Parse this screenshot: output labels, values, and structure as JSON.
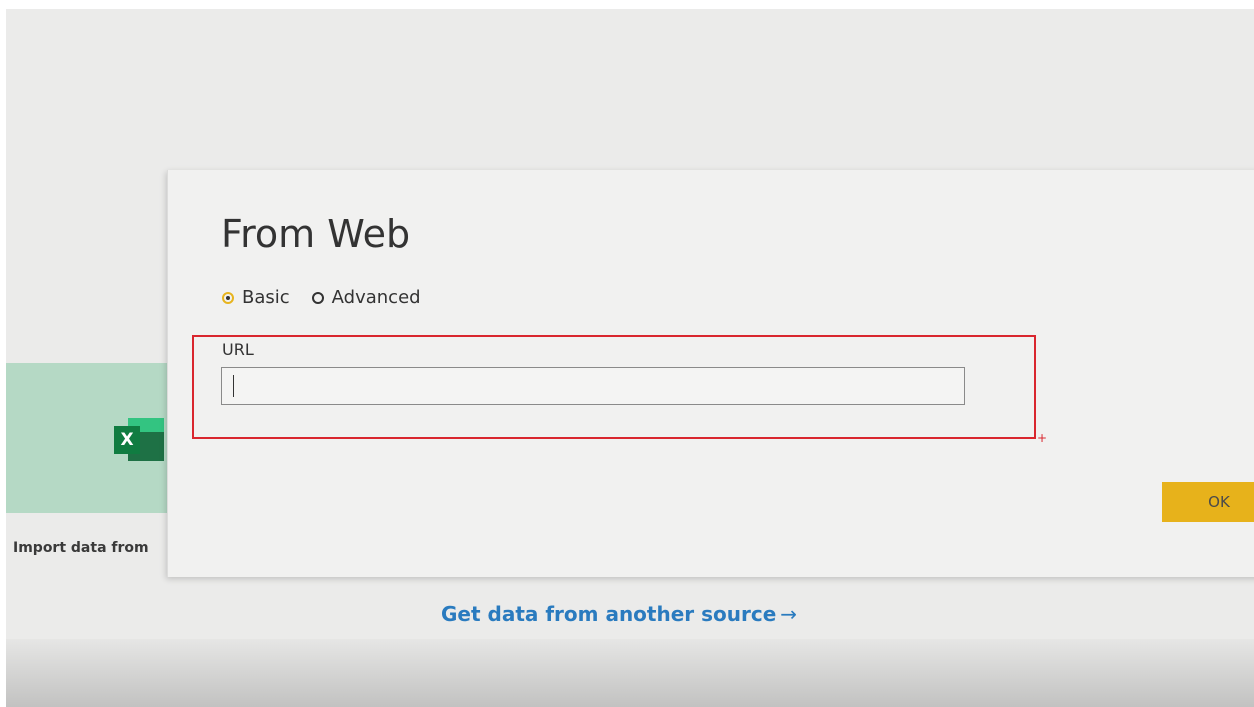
{
  "background": {
    "excel_tile_label": "Import data from",
    "excel_icon_letter": "X",
    "get_data_link": "Get data from another source",
    "get_data_arrow": "→"
  },
  "dialog": {
    "title": "From Web",
    "mode_options": [
      {
        "label": "Basic",
        "selected": true
      },
      {
        "label": "Advanced",
        "selected": false
      }
    ],
    "url_label": "URL",
    "url_value": "",
    "ok_label": "OK"
  },
  "colors": {
    "accent": "#e7b21b",
    "highlight": "#d9262e",
    "link": "#2a7bbf",
    "excel_green": "#107c41"
  }
}
